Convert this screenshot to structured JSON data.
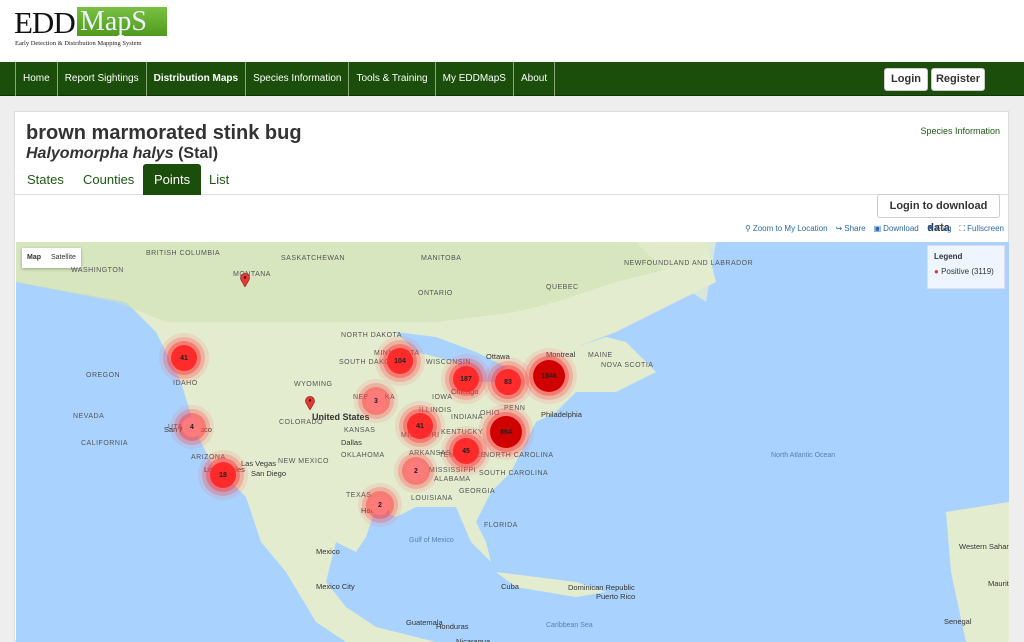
{
  "logo": {
    "edd": "EDD",
    "maps": "MapS",
    "tagline": "Early Detection & Distribution Mapping System"
  },
  "nav": {
    "items": [
      "Home",
      "Report Sightings",
      "Distribution Maps",
      "Species Information",
      "Tools & Training",
      "My EDDMapS",
      "About"
    ],
    "active": "Distribution Maps",
    "login": "Login",
    "register": "Register"
  },
  "species": {
    "common_name": "brown marmorated stink bug",
    "scientific_name": "Halyomorpha halys",
    "authority": "(Stal)",
    "species_info_link": "Species Information"
  },
  "tabs": [
    {
      "label": "States"
    },
    {
      "label": "Counties"
    },
    {
      "label": "Points",
      "active": true
    },
    {
      "label": "List"
    }
  ],
  "download_button": "Login to download data",
  "tools": [
    {
      "icon": "map-pin-icon",
      "label": "Zoom to My Location"
    },
    {
      "icon": "share-icon",
      "label": "Share"
    },
    {
      "icon": "image-icon",
      "label": "Download"
    },
    {
      "icon": "flag-icon",
      "label": "Flag"
    },
    {
      "icon": "fullscreen-icon",
      "label": "Fullscreen"
    }
  ],
  "map": {
    "type_controls": [
      "Map",
      "Satellite"
    ],
    "active_type": "Map",
    "legend": {
      "title": "Legend",
      "entry": "Positive (3119)",
      "marker_color": "#e53935"
    },
    "colors": {
      "water": "#a9d3fe",
      "land": "#e4ecd0",
      "cluster": "#ff1a1a"
    },
    "region_labels": [
      "BRITISH COLUMBIA",
      "SASKATCHEWAN",
      "MANITOBA",
      "ONTARIO",
      "QUEBEC",
      "NEWFOUNDLAND AND LABRADOR",
      "WASHINGTON",
      "MONTANA",
      "NORTH DAKOTA",
      "MINNESOTA",
      "OREGON",
      "IDAHO",
      "WYOMING",
      "SOUTH DAKOTA",
      "WISCONSIN",
      "NEBRASKA",
      "IOWA",
      "ILLINOIS",
      "INDIANA",
      "OHIO",
      "PENN",
      "NEVADA",
      "UTAH",
      "COLORADO",
      "KANSAS",
      "MISSOURI",
      "KENTUCKY",
      "CALIFORNIA",
      "ARIZONA",
      "NEW MEXICO",
      "OKLAHOMA",
      "ARKANSAS",
      "TENNESSEE",
      "NORTH CAROLINA",
      "SOUTH CAROLINA",
      "MISSISSIPPI",
      "ALABAMA",
      "GEORGIA",
      "TEXAS",
      "LOUISIANA",
      "FLORIDA",
      "MAINE",
      "NOVA SCOTIA",
      "Mexico",
      "United States",
      "Cuba",
      "Dominican Republic",
      "Puerto Rico",
      "Guatemala",
      "Honduras",
      "Nicaragua",
      "Caribbean Sea",
      "Gulf of Mexico",
      "North Atlantic Ocean",
      "Western Sahara",
      "Mauritania",
      "Senegal"
    ],
    "city_labels": [
      "Ottawa",
      "Montreal",
      "Toronto",
      "Chicago",
      "Philadelphia",
      "San Francisco",
      "Las Vegas",
      "Los Angeles",
      "San Diego",
      "Dallas",
      "Houston",
      "Mexico City"
    ],
    "clusters": [
      {
        "count": "41",
        "size": "med"
      },
      {
        "count": "104",
        "size": "med"
      },
      {
        "count": "187",
        "size": "med"
      },
      {
        "count": "83",
        "size": "med"
      },
      {
        "count": "1846",
        "size": "large"
      },
      {
        "count": "3",
        "size": "small"
      },
      {
        "count": "4",
        "size": "small"
      },
      {
        "count": "41",
        "size": "med"
      },
      {
        "count": "864",
        "size": "large"
      },
      {
        "count": "45",
        "size": "med"
      },
      {
        "count": "2",
        "size": "small"
      },
      {
        "count": "18",
        "size": "med"
      },
      {
        "count": "2",
        "size": "small"
      }
    ],
    "single_markers": 2
  }
}
